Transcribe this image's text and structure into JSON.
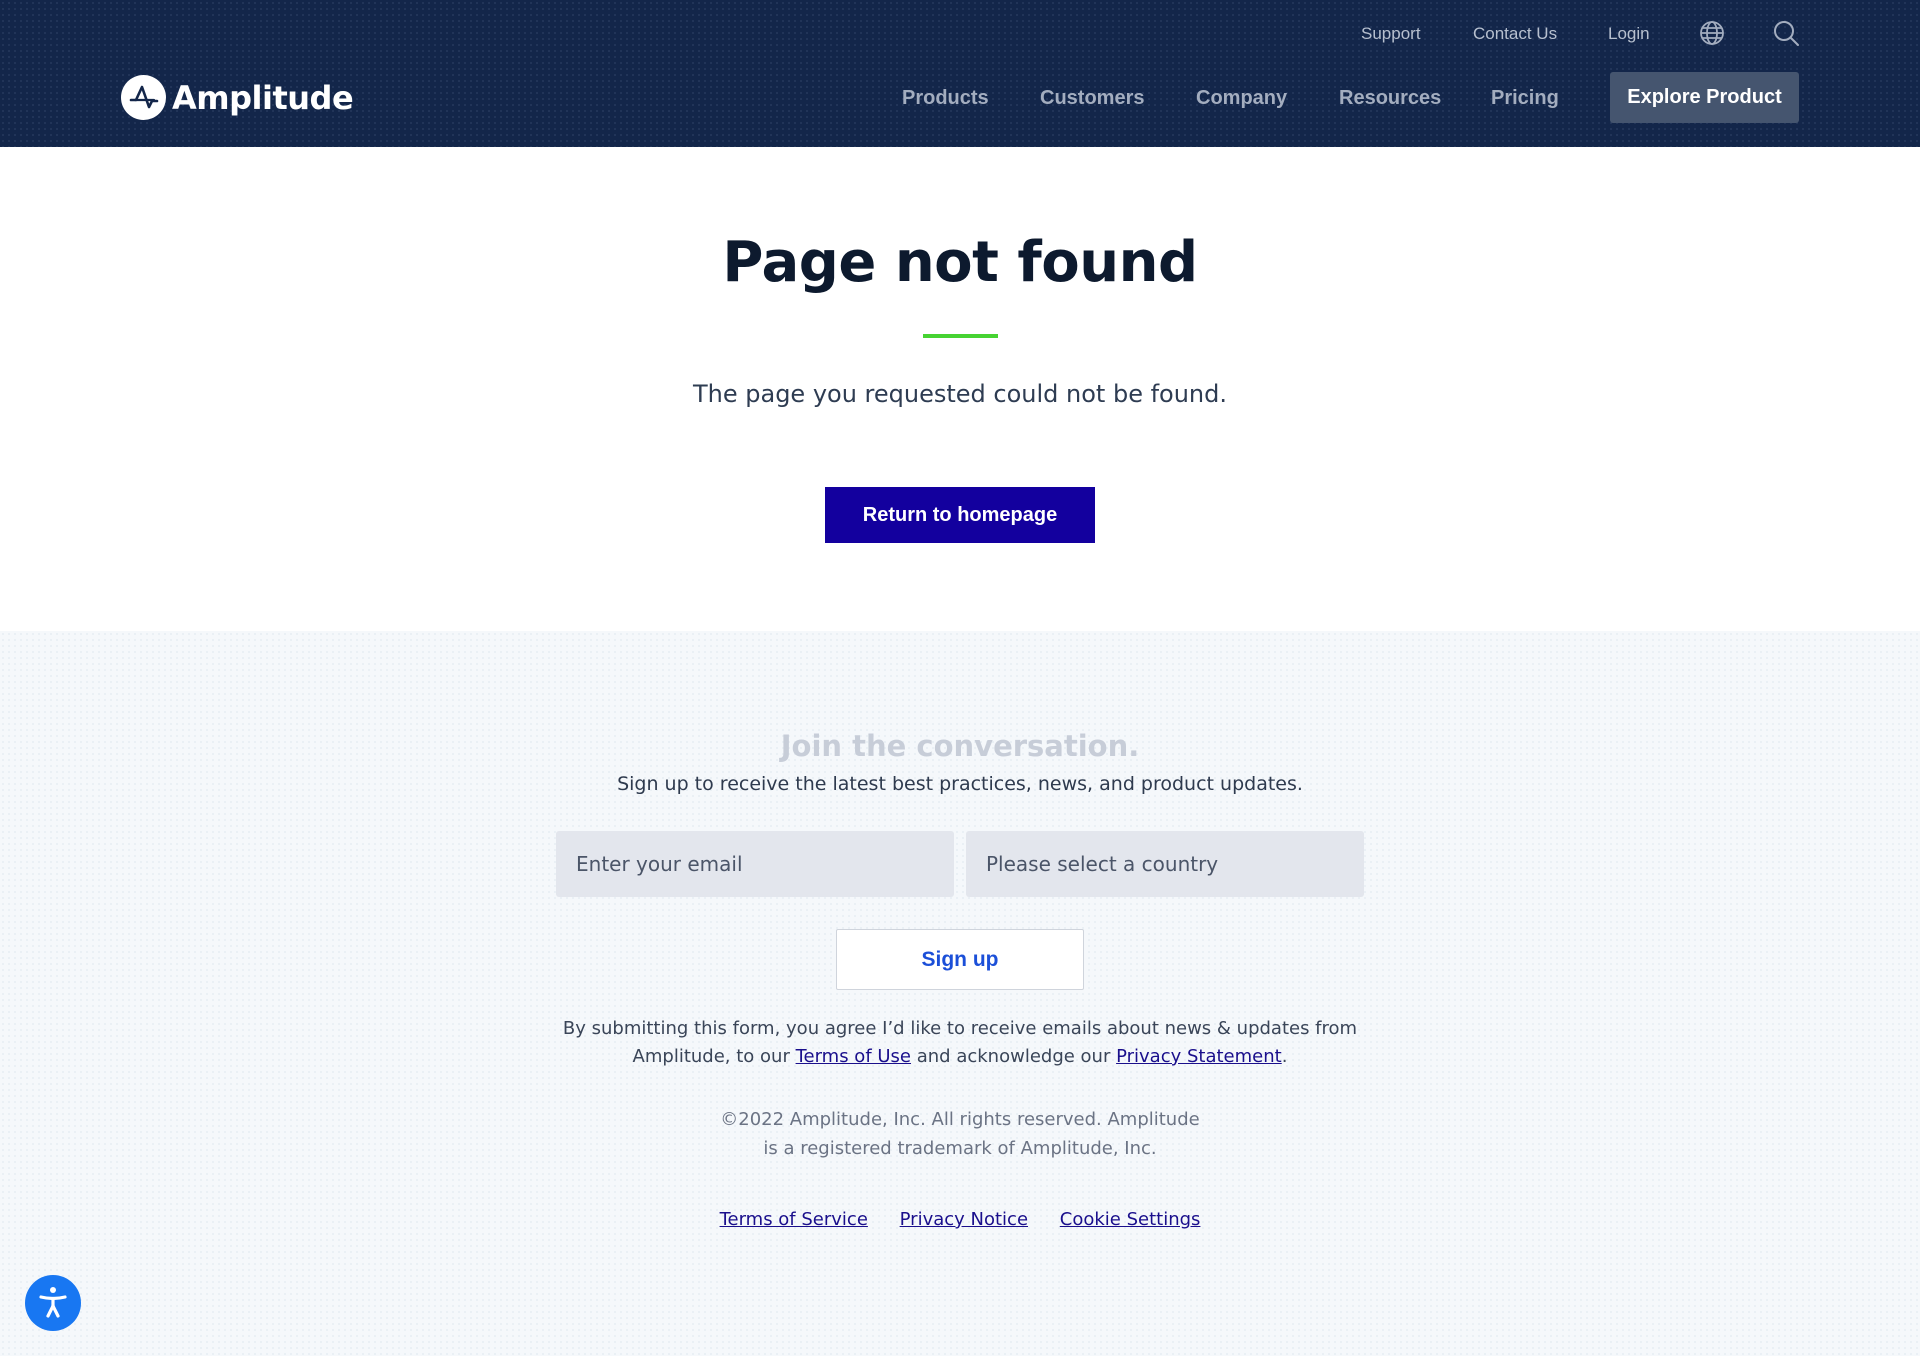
{
  "header": {
    "brand": "Amplitude",
    "utility_links": [
      {
        "label": "Support"
      },
      {
        "label": "Contact Us"
      },
      {
        "label": "Login"
      }
    ],
    "utility_icons": [
      "globe-icon",
      "search-icon"
    ],
    "main_nav": [
      {
        "label": "Products"
      },
      {
        "label": "Customers"
      },
      {
        "label": "Company"
      },
      {
        "label": "Resources"
      },
      {
        "label": "Pricing"
      }
    ],
    "cta_label": "Explore Product"
  },
  "main": {
    "title": "Page not found",
    "description": "The page you requested could not be found.",
    "button_label": "Return to homepage"
  },
  "newsletter": {
    "title": "Join the conversation.",
    "subtitle": "Sign up to receive the latest best practices, news, and product updates.",
    "email_placeholder": "Enter your email",
    "country_placeholder": "Please select a country",
    "submit_label": "Sign up",
    "consent_prefix": "By submitting this form, you agree I’d like to receive emails about news & updates from Amplitude, to our ",
    "consent_terms_link": "Terms of Use",
    "consent_middle": " and acknowledge our ",
    "consent_privacy_link": "Privacy Statement",
    "consent_suffix": "."
  },
  "footer": {
    "copyright_line1": "©2022 Amplitude, Inc. All rights reserved. Amplitude",
    "copyright_line2": "is a registered trademark of Amplitude, Inc.",
    "links": [
      {
        "label": "Terms of Service"
      },
      {
        "label": "Privacy Notice"
      },
      {
        "label": "Cookie Settings"
      }
    ]
  },
  "accessibility": {
    "icon": "accessibility-icon"
  },
  "colors": {
    "header_bg": "#13264a",
    "accent_green": "#46d332",
    "primary_button": "#13009e",
    "explore_button": "#45556f",
    "signup_text": "#1b4fd8",
    "link": "#1a0f8c",
    "accessibility": "#1877f2"
  }
}
